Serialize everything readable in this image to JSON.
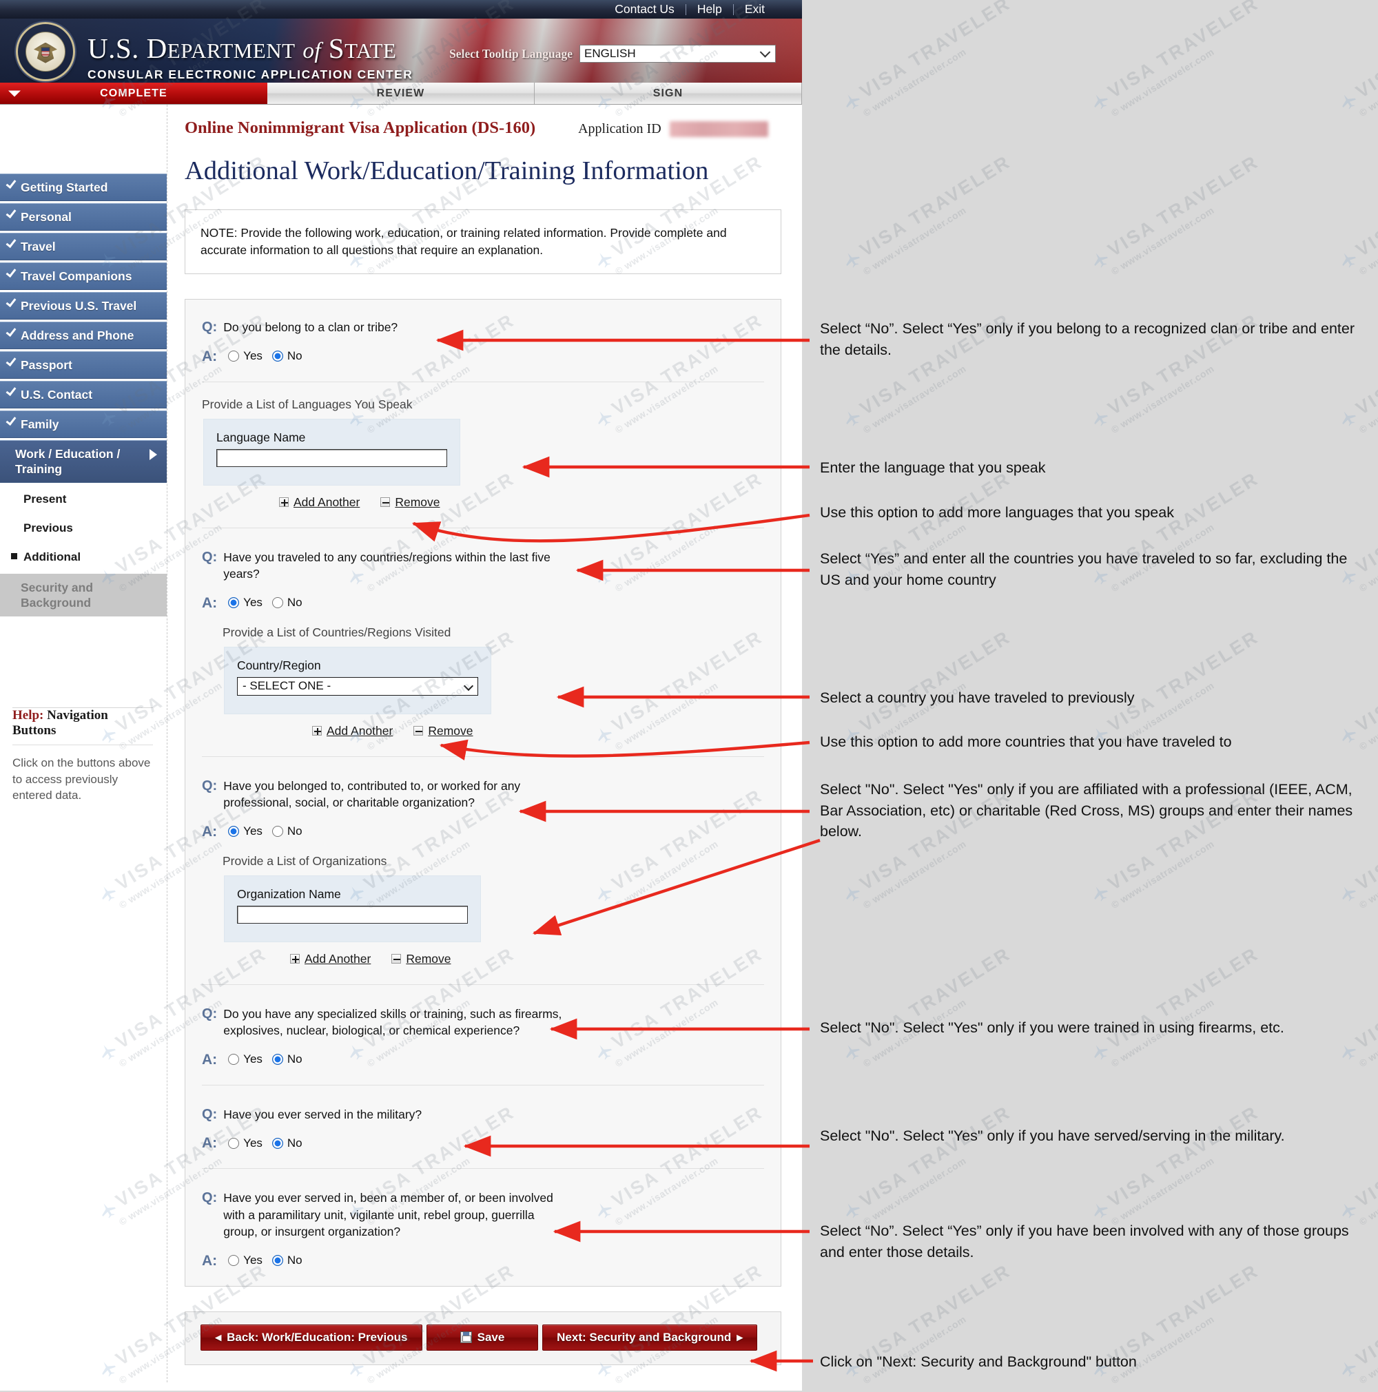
{
  "utility": {
    "links": [
      "Contact Us",
      "Help",
      "Exit"
    ]
  },
  "banner": {
    "title_line1_prefix": "U.S. D",
    "title_department": "EPARTMENT",
    "title_of": "of",
    "title_state_prefix": "S",
    "title_state": "TATE",
    "subtitle": "CONSULAR ELECTRONIC APPLICATION CENTER",
    "tooltip_language_label": "Select Tooltip Language",
    "tooltip_language_value": "ENGLISH"
  },
  "tabs": [
    {
      "label": "COMPLETE",
      "active": true
    },
    {
      "label": "REVIEW",
      "active": false
    },
    {
      "label": "SIGN",
      "active": false
    }
  ],
  "form": {
    "form_title": "Online Nonimmigrant Visa Application (DS-160)",
    "application_id_label": "Application ID",
    "application_id_value": "",
    "page_title": "Additional Work/Education/Training Information",
    "note": "NOTE: Provide the following work, education, or training related information. Provide complete and accurate information to all questions that require an explanation."
  },
  "sidebar": {
    "items": [
      {
        "label": "Getting Started",
        "state": "done"
      },
      {
        "label": "Personal",
        "state": "done"
      },
      {
        "label": "Travel",
        "state": "done"
      },
      {
        "label": "Travel Companions",
        "state": "done"
      },
      {
        "label": "Previous U.S. Travel",
        "state": "done"
      },
      {
        "label": "Address and Phone",
        "state": "done"
      },
      {
        "label": "Passport",
        "state": "done"
      },
      {
        "label": "U.S. Contact",
        "state": "done"
      },
      {
        "label": "Family",
        "state": "done"
      }
    ],
    "current_item": "Work / Education / Training",
    "sub_items": [
      {
        "label": "Present",
        "selected": false
      },
      {
        "label": "Previous",
        "selected": false
      },
      {
        "label": "Additional",
        "selected": true
      }
    ],
    "disabled_item": "Security and Background",
    "help_title_prefix": "Help:",
    "help_title": " Navigation Buttons",
    "help_text": "Click on the buttons above to access previously entered data."
  },
  "questions": [
    {
      "q_mark": "Q:",
      "a_mark": "A:",
      "text": "Do you belong to a clan or tribe?",
      "answer": "No",
      "options": [
        "Yes",
        "No"
      ],
      "sub_label": "Provide a List of Languages You Speak",
      "field_label": "Language Name",
      "field_value": "",
      "add_label": "Add Another",
      "remove_label": "Remove"
    },
    {
      "q_mark": "Q:",
      "a_mark": "A:",
      "text": "Have you traveled to any countries/regions within the last five years?",
      "answer": "Yes",
      "options": [
        "Yes",
        "No"
      ],
      "sub_label": "Provide a List of Countries/Regions Visited",
      "field_label": "Country/Region",
      "field_value": "- SELECT ONE -",
      "add_label": "Add Another",
      "remove_label": "Remove"
    },
    {
      "q_mark": "Q:",
      "a_mark": "A:",
      "text": "Have you belonged to, contributed to, or worked for any professional, social, or charitable organization?",
      "answer": "Yes",
      "options": [
        "Yes",
        "No"
      ],
      "sub_label": "Provide a List of Organizations",
      "field_label": "Organization Name",
      "field_value": "",
      "add_label": "Add Another",
      "remove_label": "Remove"
    },
    {
      "q_mark": "Q:",
      "a_mark": "A:",
      "text": "Do you have any specialized skills or training, such as firearms, explosives, nuclear, biological, or chemical experience?",
      "answer": "No",
      "options": [
        "Yes",
        "No"
      ]
    },
    {
      "q_mark": "Q:",
      "a_mark": "A:",
      "text": "Have you ever served in the military?",
      "answer": "No",
      "options": [
        "Yes",
        "No"
      ]
    },
    {
      "q_mark": "Q:",
      "a_mark": "A:",
      "text": "Have you ever served in, been a member of, or been involved with a paramilitary unit, vigilante unit, rebel group, guerrilla group, or insurgent organization?",
      "answer": "No",
      "options": [
        "Yes",
        "No"
      ]
    }
  ],
  "nav_buttons": {
    "back": "Back: Work/Education: Previous",
    "save": "Save",
    "next": "Next: Security and Background"
  },
  "annotations": [
    "Select “No”. Select “Yes” only if you belong to a recognized clan or tribe and enter the details.",
    "Enter the language that you speak",
    "Use this option to add more languages that you speak",
    "Select “Yes” and enter all the countries you have traveled to so far, excluding the US and your home country",
    "Select a country you have traveled to previously",
    "Use this option to add more countries that you have traveled to",
    "Select \"No\". Select \"Yes\" only if you are affiliated with a professional (IEEE, ACM, Bar Association, etc) or charitable (Red Cross, MS) groups and enter their names below.",
    "Select \"No\". Select \"Yes\" only if you were trained in using firearms, etc.",
    "Select \"No\". Select \"Yes\" only if you have served/serving in the military.",
    "Select “No”. Select “Yes” only if you have been involved with any of those groups and enter those details.",
    "Click on \"Next: Security and Background\" button"
  ],
  "watermark": {
    "line1": "VISA TRAVELER",
    "line2": "© www.visatraveler.com"
  },
  "colors": {
    "accent_red": "#8e0d0d",
    "title_blue": "#1b2a5e",
    "nav_blue": "#4a6a9a",
    "arrow_red": "#e8291e",
    "panel_bg": "#f7f7f7",
    "annotation_bg": "#d9d9d9"
  }
}
